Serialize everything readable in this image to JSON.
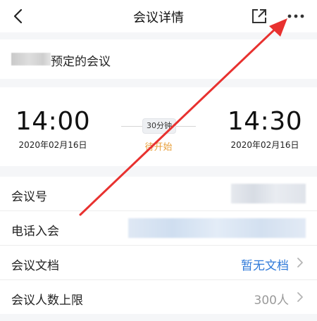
{
  "header": {
    "title": "会议详情",
    "back_icon": "chevron-left-icon",
    "share_icon": "external-share-icon",
    "more_icon": "more-dots-icon"
  },
  "organizer": {
    "suffix": "预定的会议"
  },
  "schedule": {
    "start_time": "14:00",
    "start_date": "2020年02月16日",
    "end_time": "14:30",
    "end_date": "2020年02月16日",
    "duration": "30分钟",
    "status": "待开始",
    "status_color": "#e8a03c"
  },
  "details": {
    "rows": [
      {
        "label": "会议号"
      },
      {
        "label": "电话入会"
      },
      {
        "label": "会议文档",
        "value": "暂无文档"
      },
      {
        "label": "会议人数上限",
        "value": "300人"
      }
    ]
  },
  "colors": {
    "link": "#2f7ad9",
    "annotation_arrow": "#e8312f"
  }
}
